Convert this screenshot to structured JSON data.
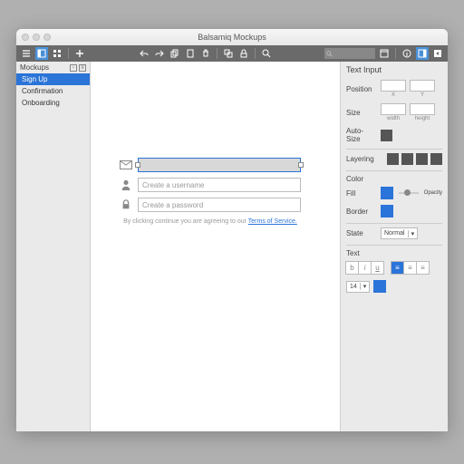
{
  "window": {
    "title": "Balsamiq Mockups"
  },
  "sidebar": {
    "header": "Mockups",
    "items": [
      {
        "label": "Sign Up",
        "selected": true
      },
      {
        "label": "Confirmation",
        "selected": false
      },
      {
        "label": "Onboarding",
        "selected": false
      }
    ]
  },
  "mockup": {
    "email_placeholder": "",
    "username_placeholder": "Create a username",
    "password_placeholder": "Create a password",
    "terms_prefix": "By clicking continue you are agreeing to our ",
    "terms_link": "Terms of Service."
  },
  "props": {
    "title": "Text Input",
    "labels": {
      "position": "Position",
      "size": "Size",
      "autosize": "Auto-Size",
      "layering": "Layering",
      "color": "Color",
      "fill": "Fill",
      "border": "Border",
      "state": "State",
      "text": "Text",
      "opacity": "Opacity",
      "x": "X",
      "y": "Y",
      "width": "width",
      "height": "height"
    },
    "state_value": "Normal",
    "fontsize": "14",
    "fill_color": "#2b74d9",
    "border_color": "#2b74d9"
  }
}
